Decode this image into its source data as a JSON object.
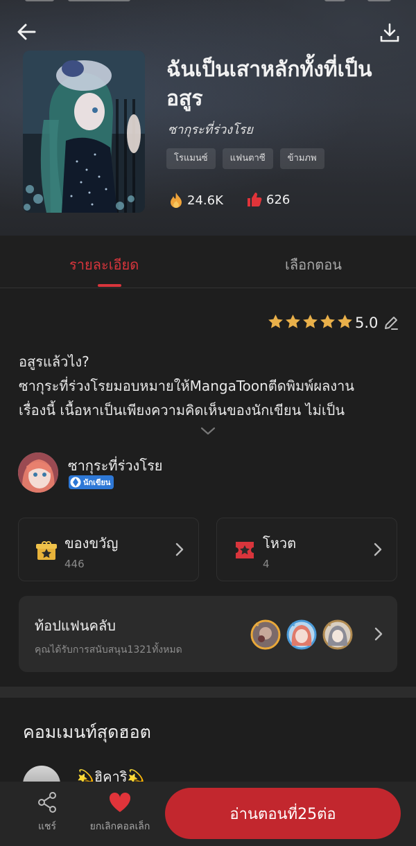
{
  "book": {
    "title": "ฉันเป็นเสาหลักทั้งที่เป็นอสูร",
    "author": "ซากุระที่ร่วงโรย",
    "tags": [
      "โรแมนซ์",
      "แฟนตาซี",
      "ข้ามภพ"
    ],
    "views": "24.6K",
    "likes": "626"
  },
  "tabs": [
    {
      "label": "รายละเอียด",
      "active": true
    },
    {
      "label": "เลือกตอน",
      "active": false
    }
  ],
  "rating": {
    "value": "5.0",
    "stars": 5
  },
  "synopsis": [
    "อสูรแล้วไง?",
    "ซากุระที่ร่วงโรยมอบหมายให้MangaToonตีดพิมพ์ผลงาน",
    "เรื่องนี้ เนื้อหาเป็นเพียงความคิดเห็นของนักเขียน ไม่เป็น"
  ],
  "author_card": {
    "name": "ซากุระที่ร่วงโรย",
    "badge": "นักเขียน"
  },
  "gift_card": {
    "label": "ของขวัญ",
    "count": "446"
  },
  "vote_card": {
    "label": "โหวต",
    "count": "4"
  },
  "fanclub": {
    "title": "ท้อปแฟนคลับ",
    "subtitle": "คุณได้รับการสนับสนุน1321ทั้งหมด"
  },
  "comments": {
    "title": "คอมเมนท์สุดฮอต",
    "first_name": "💫ฮิคาริ💫"
  },
  "bottom_bar": {
    "share_label": "แชร์",
    "uncollect_label": "ยกเลิกคอลเล็ก",
    "read_button": "อ่านตอนที่25ต่อ"
  },
  "colors": {
    "accent_red": "#c2272e",
    "tab_active": "#d8353c",
    "star_gold": "#e9b04a",
    "background": "#1e1e1e"
  }
}
